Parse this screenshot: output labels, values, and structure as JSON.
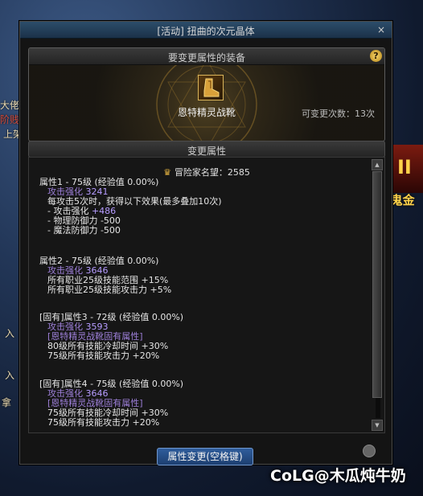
{
  "background": {
    "left_texts": [
      "大佬",
      "阶贱",
      "上架",
      "入",
      "入",
      "拿"
    ],
    "right_logo": "II",
    "right_label": "A鬼金",
    "watermark": "CoLG@木瓜炖牛奶"
  },
  "window": {
    "title": "[活动] 扭曲的次元晶体",
    "close_icon": "×"
  },
  "equipment": {
    "header": "要变更属性的装备",
    "help": "?",
    "item_name": "恩特精灵战靴",
    "change_count": "可变更次数：13次"
  },
  "attributes": {
    "header": "变更属性",
    "fame_label": "冒险家名望：2585",
    "blocks": [
      {
        "title": "属性1 - 75级 (经验值 0.00%)",
        "lines": [
          {
            "label": "攻击强化",
            "value": "3241",
            "style": "purple"
          },
          {
            "label": "每攻击5次时，获得以下效果(最多叠加10次)",
            "value": "",
            "style": "white"
          },
          {
            "label": "- 攻击强化",
            "value": "+486",
            "style": "white"
          },
          {
            "label": "- 物理防御力 -500",
            "value": "",
            "style": "white"
          },
          {
            "label": "- 魔法防御力 -500",
            "value": "",
            "style": "white"
          }
        ]
      },
      {
        "title": "属性2 - 75级 (经验值 0.00%)",
        "lines": [
          {
            "label": "攻击强化",
            "value": "3646",
            "style": "purple"
          },
          {
            "label": "所有职业25级技能范围 +15%",
            "value": "",
            "style": "white"
          },
          {
            "label": "所有职业25级技能攻击力 +5%",
            "value": "",
            "style": "white"
          }
        ]
      },
      {
        "title": "[固有]属性3 - 72级 (经验值 0.00%)",
        "lines": [
          {
            "label": "攻击强化",
            "value": "3593",
            "style": "purple"
          },
          {
            "label": "[恩特精灵战靴固有属性]",
            "value": "",
            "style": "purple"
          },
          {
            "label": "80级所有技能冷却时间 +30%",
            "value": "",
            "style": "white"
          },
          {
            "label": "75级所有技能攻击力 +20%",
            "value": "",
            "style": "white"
          }
        ]
      },
      {
        "title": "[固有]属性4 - 75级 (经验值 0.00%)",
        "lines": [
          {
            "label": "攻击强化",
            "value": "3646",
            "style": "purple"
          },
          {
            "label": "[恩特精灵战靴固有属性]",
            "value": "",
            "style": "purple"
          },
          {
            "label": "75级所有技能冷却时间 +30%",
            "value": "",
            "style": "white"
          },
          {
            "label": "75级所有技能攻击力 +20%",
            "value": "",
            "style": "white"
          }
        ]
      }
    ]
  },
  "action": {
    "change_button": "属性变更(空格键)"
  }
}
